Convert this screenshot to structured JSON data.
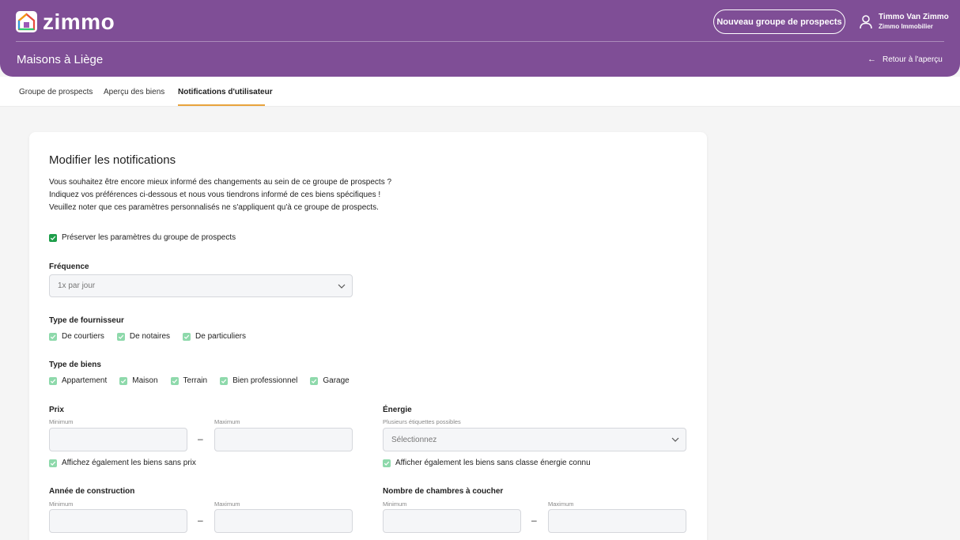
{
  "brand": {
    "name": "zimmo"
  },
  "header": {
    "new_group_button": "Nouveau groupe de prospects",
    "user_name": "Timmo Van Zimmo",
    "user_company": "Zimmo Immobilier",
    "page_title": "Maisons à Liège",
    "back_link": "Retour à l'aperçu"
  },
  "tabs": [
    {
      "label": "Groupe de prospects",
      "active": false
    },
    {
      "label": "Aperçu des biens",
      "active": false
    },
    {
      "label": "Notifications d'utilisateur",
      "active": true
    }
  ],
  "form": {
    "title": "Modifier les notifications",
    "intro": [
      "Vous souhaitez être encore mieux informé des changements au sein de ce groupe de prospects ?",
      "Indiquez vos préférences ci-dessous et nous vous tiendrons informé de ces biens spécifiques !",
      "Veuillez noter que ces paramètres personnalisés ne s'appliquent qu'à ce groupe de prospects."
    ],
    "preserve_checkbox": "Préserver les paramètres du groupe de prospects",
    "frequency": {
      "label": "Fréquence",
      "value": "1x par jour"
    },
    "supplier_type": {
      "label": "Type de fournisseur",
      "options": [
        "De courtiers",
        "De notaires",
        "De particuliers"
      ]
    },
    "property_type": {
      "label": "Type de biens",
      "options": [
        "Appartement",
        "Maison",
        "Terrain",
        "Bien professionnel",
        "Garage"
      ]
    },
    "price": {
      "label": "Prix",
      "min_label": "Minimum",
      "max_label": "Maximum",
      "separator": "–",
      "checkbox": "Affichez également les biens sans prix"
    },
    "energy": {
      "label": "Énergie",
      "hint": "Plusieurs étiquettes possibles",
      "placeholder": "Sélectionnez",
      "checkbox": "Afficher également les biens sans classe énergie connu"
    },
    "construction_year": {
      "label": "Année de construction",
      "min_label": "Minimum",
      "max_label": "Maximum",
      "separator": "–"
    },
    "bedrooms": {
      "label": "Nombre de chambres à coucher",
      "min_label": "Minimum",
      "max_label": "Maximum",
      "separator": "–"
    }
  },
  "colors": {
    "header_bg": "#7f4e96",
    "tab_accent": "#e8a33c",
    "checkbox_checked": "#1e9e4a",
    "checkbox_light": "#8ed9ab"
  }
}
